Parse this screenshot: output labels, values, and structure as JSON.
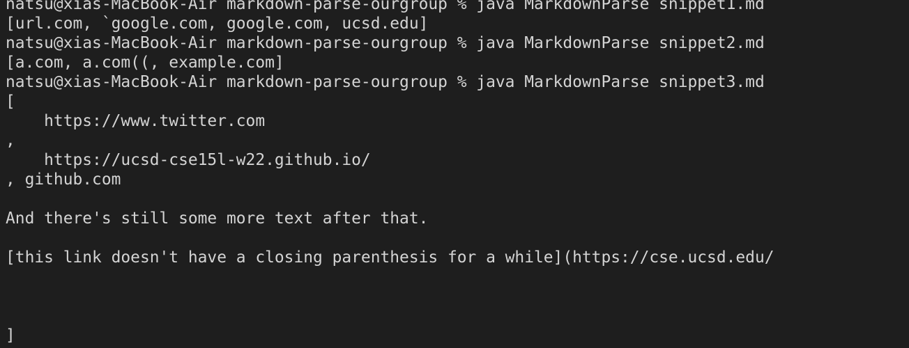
{
  "terminal": {
    "lines": [
      "natsu@xias-MacBook-Air markdown-parse-ourgroup % java MarkdownParse snippet1.md",
      "[url.com, `google.com, google.com, ucsd.edu]",
      "natsu@xias-MacBook-Air markdown-parse-ourgroup % java MarkdownParse snippet2.md",
      "[a.com, a.com((, example.com]",
      "natsu@xias-MacBook-Air markdown-parse-ourgroup % java MarkdownParse snippet3.md",
      "[",
      "    https://www.twitter.com",
      ",",
      "    https://ucsd-cse15l-w22.github.io/",
      ", github.com",
      "",
      "And there's still some more text after that.",
      "",
      "[this link doesn't have a closing parenthesis for a while](https://cse.ucsd.edu/",
      "",
      "",
      "",
      "]"
    ]
  }
}
